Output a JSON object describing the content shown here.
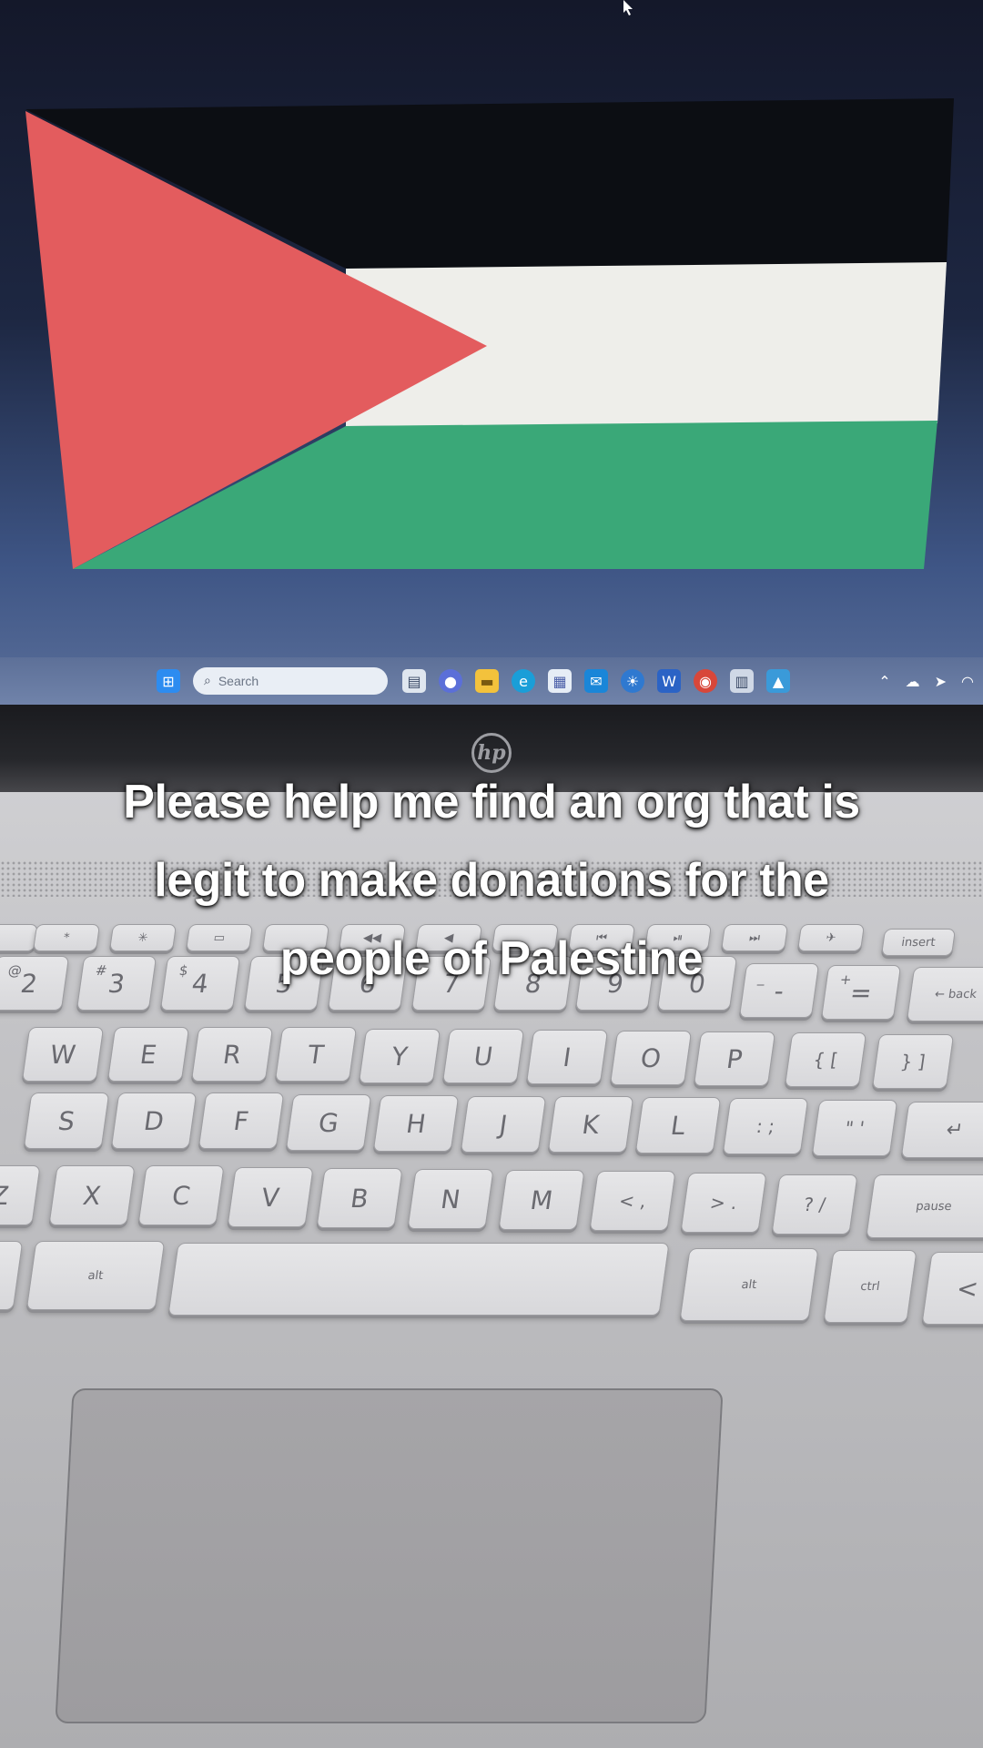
{
  "caption": {
    "line1": "Please help me find an org that is",
    "line2": "legit to make donations for the",
    "line3": "people of Palestine"
  },
  "laptop": {
    "brand_logo": "hp",
    "taskbar": {
      "search_placeholder": "Search",
      "icons": [
        "windows-start-icon",
        "copilot-icon",
        "files-icon",
        "chat-icon",
        "file-explorer-icon",
        "edge-icon",
        "store-icon",
        "mail-icon",
        "weather-icon",
        "word-icon",
        "chrome-icon",
        "notepad-icon",
        "photos-icon"
      ],
      "tray_icons": [
        "chevron-up-icon",
        "cloud-icon",
        "location-icon",
        "wifi-icon"
      ]
    }
  },
  "flag_colors": {
    "black": "#0d0f14",
    "white": "#f1f1ee",
    "green": "#3aa979",
    "red": "#e05a5e"
  },
  "keyboard": {
    "fn_row": [
      "*",
      "✳",
      "▭",
      "",
      "◀◀",
      "◀",
      "",
      "⏮",
      "⏯",
      "⏭",
      "✈",
      "insert"
    ],
    "num_row": [
      {
        "main": "2",
        "sub": "@"
      },
      {
        "main": "3",
        "sub": "#"
      },
      {
        "main": "4",
        "sub": "$"
      },
      {
        "main": "5",
        "sub": ""
      },
      {
        "main": "6",
        "sub": ""
      },
      {
        "main": "7",
        "sub": ""
      },
      {
        "main": "8",
        "sub": ""
      },
      {
        "main": "9",
        "sub": ""
      },
      {
        "main": "0",
        "sub": ""
      },
      {
        "main": "-",
        "sub": "_"
      },
      {
        "main": "=",
        "sub": "+"
      },
      {
        "main": "← back",
        "sub": ""
      }
    ],
    "qwerty_row": [
      "W",
      "E",
      "R",
      "T",
      "Y",
      "U",
      "I",
      "O",
      "P",
      "{ [",
      "} ]"
    ],
    "home_row": [
      "S",
      "D",
      "F",
      "G",
      "H",
      "J",
      "K",
      "L",
      ": ;",
      "\" '",
      "↵"
    ],
    "bottom_row": [
      "Z",
      "X",
      "C",
      "V",
      "B",
      "N",
      "M",
      "< ,",
      "> .",
      "? /",
      "pause"
    ],
    "space_row": [
      "alt",
      "",
      "alt",
      "ctrl",
      "<"
    ]
  }
}
